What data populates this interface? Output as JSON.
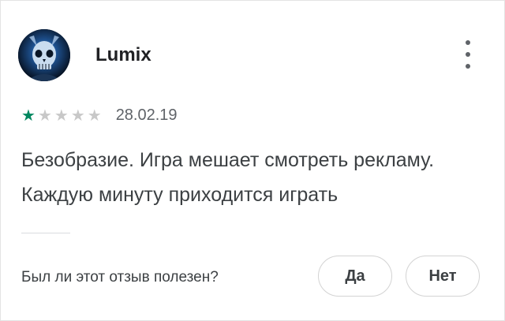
{
  "review": {
    "author": "Lumix",
    "avatar_icon": "skull-avatar",
    "rating": 1,
    "rating_max": 5,
    "star_color": "#01875f",
    "date": "28.02.19",
    "text": "Безобразие. Игра мешает смотреть рекламу. Каждую минуту приходится играть"
  },
  "helpful": {
    "question": "Был ли этот отзыв полезен?",
    "yes_label": "Да",
    "no_label": "Нет"
  }
}
